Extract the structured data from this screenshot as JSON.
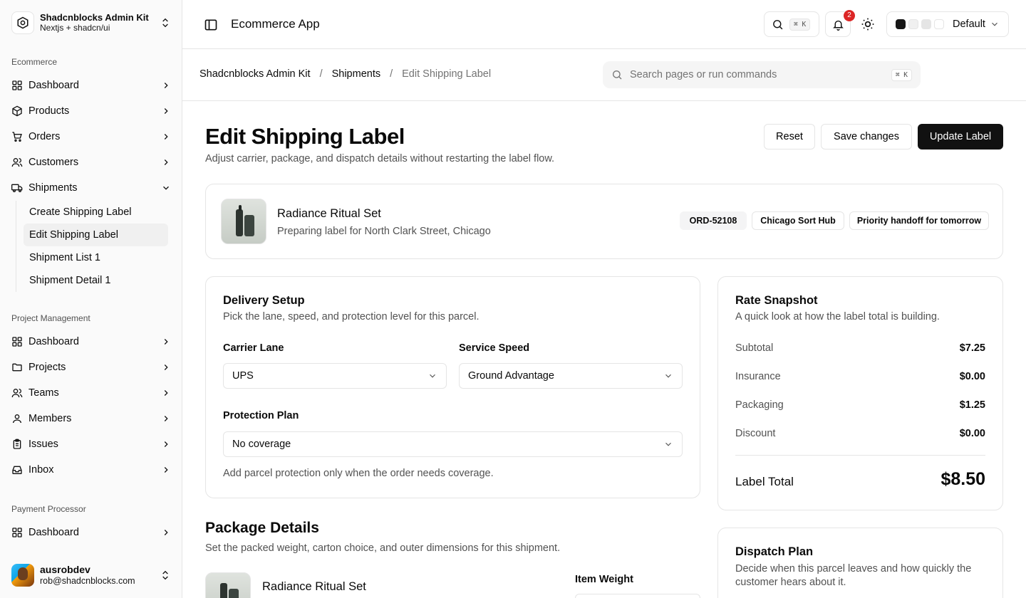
{
  "sidebar": {
    "brand": {
      "title": "Shadcnblocks Admin Kit",
      "subtitle": "Nextjs + shadcn/ui"
    },
    "groups": [
      {
        "label": "Ecommerce",
        "items": [
          {
            "label": "Dashboard",
            "icon": "dashboard-icon"
          },
          {
            "label": "Products",
            "icon": "package-icon"
          },
          {
            "label": "Orders",
            "icon": "cart-icon"
          },
          {
            "label": "Customers",
            "icon": "users-icon"
          },
          {
            "label": "Shipments",
            "icon": "truck-icon",
            "expanded": true,
            "children": [
              "Create Shipping Label",
              "Edit Shipping Label",
              "Shipment List 1",
              "Shipment Detail 1"
            ],
            "active_child": "Edit Shipping Label"
          }
        ]
      },
      {
        "label": "Project Management",
        "items": [
          {
            "label": "Dashboard",
            "icon": "dashboard-icon"
          },
          {
            "label": "Projects",
            "icon": "folder-icon"
          },
          {
            "label": "Teams",
            "icon": "users-icon"
          },
          {
            "label": "Members",
            "icon": "user-icon"
          },
          {
            "label": "Issues",
            "icon": "clipboard-icon"
          },
          {
            "label": "Inbox",
            "icon": "inbox-icon"
          }
        ]
      },
      {
        "label": "Payment Processor",
        "items": [
          {
            "label": "Dashboard",
            "icon": "dashboard-icon"
          }
        ]
      }
    ],
    "user": {
      "name": "ausrobdev",
      "email": "rob@shadcnblocks.com"
    }
  },
  "header": {
    "title": "Ecommerce App",
    "search_kbd": "⌘ K",
    "notification_count": "2",
    "theme_label": "Default",
    "theme_swatches": [
      "#171717",
      "#f0f0f0",
      "#e5e5e5",
      "#ffffff"
    ]
  },
  "breadcrumb": {
    "items": [
      "Shadcnblocks Admin Kit",
      "Shipments",
      "Edit Shipping Label"
    ],
    "separator": "/"
  },
  "command": {
    "placeholder": "Search pages or run commands",
    "kbd": "⌘ K"
  },
  "page": {
    "title": "Edit Shipping Label",
    "subtitle": "Adjust carrier, package, and dispatch details without restarting the label flow.",
    "actions": {
      "reset": "Reset",
      "save": "Save changes",
      "update": "Update Label"
    }
  },
  "product": {
    "name": "Radiance Ritual Set",
    "subtitle": "Preparing label for North Clark Street, Chicago",
    "tags": [
      "ORD-52108",
      "Chicago Sort Hub",
      "Priority handoff for tomorrow"
    ]
  },
  "delivery": {
    "title": "Delivery Setup",
    "description": "Pick the lane, speed, and protection level for this parcel.",
    "carrier_label": "Carrier Lane",
    "carrier_value": "UPS",
    "speed_label": "Service Speed",
    "speed_value": "Ground Advantage",
    "protection_label": "Protection Plan",
    "protection_value": "No coverage",
    "protection_hint": "Add parcel protection only when the order needs coverage."
  },
  "rate": {
    "title": "Rate Snapshot",
    "description": "A quick look at how the label total is building.",
    "rows": [
      {
        "label": "Subtotal",
        "value": "$7.25"
      },
      {
        "label": "Insurance",
        "value": "$0.00"
      },
      {
        "label": "Packaging",
        "value": "$1.25"
      },
      {
        "label": "Discount",
        "value": "$0.00"
      }
    ],
    "total_label": "Label Total",
    "total_value": "$8.50"
  },
  "dispatch": {
    "title": "Dispatch Plan",
    "description": "Decide when this parcel leaves and how quickly the customer hears about it."
  },
  "package": {
    "title": "Package Details",
    "description": "Set the packed weight, carton choice, and outer dimensions for this shipment.",
    "item_name": "Radiance Ritual Set",
    "weight_label": "Item Weight"
  }
}
